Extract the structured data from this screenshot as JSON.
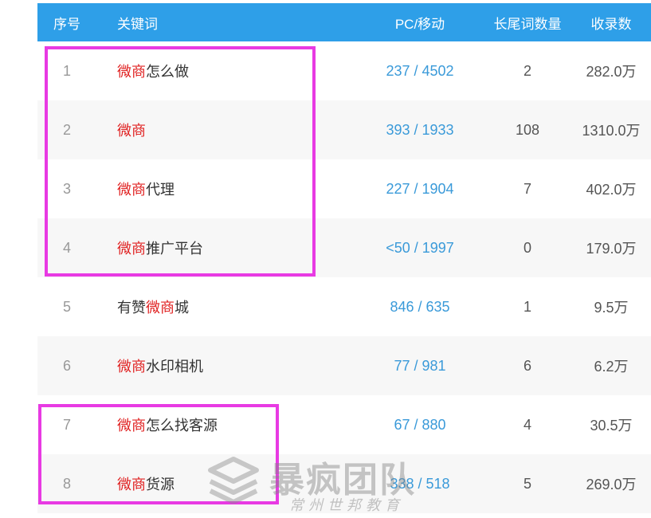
{
  "table": {
    "headers": {
      "index": "序号",
      "keyword": "关键词",
      "pc_mobile": "PC/移动",
      "long_tail": "长尾词数量",
      "indexed": "收录数"
    },
    "rows": [
      {
        "index": "1",
        "kw_pre": "",
        "kw_red": "微商",
        "kw_post": "怎么做",
        "pc_mobile": "237 / 4502",
        "long_tail": "2",
        "indexed": "282.0万"
      },
      {
        "index": "2",
        "kw_pre": "",
        "kw_red": "微商",
        "kw_post": "",
        "pc_mobile": "393 / 1933",
        "long_tail": "108",
        "indexed": "1310.0万"
      },
      {
        "index": "3",
        "kw_pre": "",
        "kw_red": "微商",
        "kw_post": "代理",
        "pc_mobile": "227 / 1904",
        "long_tail": "7",
        "indexed": "402.0万"
      },
      {
        "index": "4",
        "kw_pre": "",
        "kw_red": "微商",
        "kw_post": "推广平台",
        "pc_mobile": "<50 / 1997",
        "long_tail": "0",
        "indexed": "179.0万"
      },
      {
        "index": "5",
        "kw_pre": "有赞",
        "kw_red": "微商",
        "kw_post": "城",
        "pc_mobile": "846 / 635",
        "long_tail": "1",
        "indexed": "9.5万"
      },
      {
        "index": "6",
        "kw_pre": "",
        "kw_red": "微商",
        "kw_post": "水印相机",
        "pc_mobile": "77 / 981",
        "long_tail": "6",
        "indexed": "6.2万"
      },
      {
        "index": "7",
        "kw_pre": "",
        "kw_red": "微商",
        "kw_post": "怎么找客源",
        "pc_mobile": "67 / 880",
        "long_tail": "4",
        "indexed": "30.5万"
      },
      {
        "index": "8",
        "kw_pre": "",
        "kw_red": "微商",
        "kw_post": "货源",
        "pc_mobile": "338 / 518",
        "long_tail": "5",
        "indexed": "269.0万"
      }
    ]
  },
  "watermark": {
    "main": "暴疯团队",
    "sub": "常州世邦教育"
  },
  "colors": {
    "header_bg": "#2e9fe8",
    "highlight": "#e83ae3",
    "keyword_accent": "#e02222",
    "link": "#3a9ad9"
  }
}
